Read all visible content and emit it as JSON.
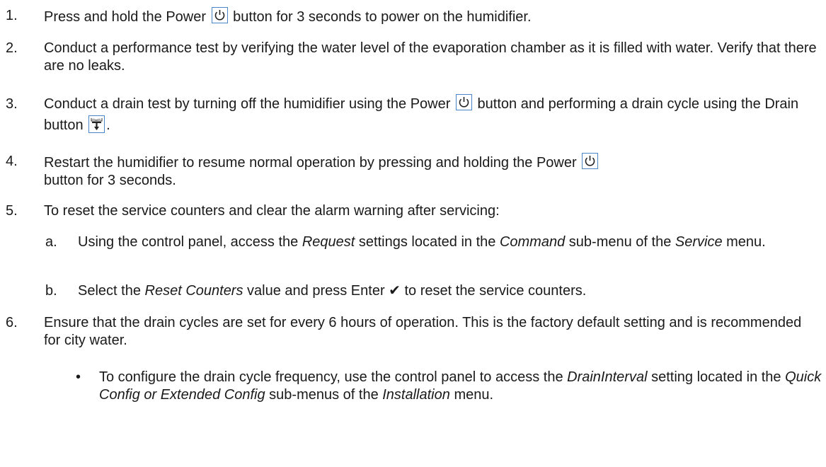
{
  "steps": [
    {
      "num": "1.",
      "parts": {
        "a": "Press and hold the Power",
        "b": "button for 3 seconds to power on the humidifier."
      }
    },
    {
      "num": "2.",
      "parts": {
        "a": "Conduct a performance test by verifying the water level of the evaporation chamber as it is filled with water. Verify that there are no leaks."
      }
    },
    {
      "num": "3.",
      "parts": {
        "a": "Conduct a drain test by turning off the humidifier using the Power",
        "b": "button and performing a drain cycle using the Drain button",
        "c": "."
      }
    },
    {
      "num": "4.",
      "parts": {
        "a": "Restart the humidifier to resume normal operation by pressing and holding the Power",
        "b": "button for 3 seconds."
      }
    },
    {
      "num": "5.",
      "parts": {
        "a": "To reset the service counters and clear the alarm warning after servicing:"
      }
    },
    {
      "num": "6.",
      "parts": {
        "a": "Ensure that the drain cycles are set for every 6 hours of operation. This is the factory default setting and is recommended for city water."
      }
    }
  ],
  "substeps": [
    {
      "num": "a.",
      "parts": {
        "a": "Using the control panel, access the",
        "b": "Request",
        "c": "settings located in the",
        "d": "Command",
        "e": "sub-menu of the",
        "f": "Service",
        "g": "menu."
      }
    },
    {
      "num": "b.",
      "parts": {
        "a": "Select the",
        "b": "Reset Counters",
        "c": "value and press Enter",
        "d": "✔",
        "e": "to reset the service counters."
      }
    }
  ],
  "bullet": {
    "dot": "•",
    "parts": {
      "a": "To configure the drain cycle frequency, use the control panel to access the",
      "b": "DrainInterval",
      "c": "setting located in the",
      "d": "Quick Config or Extended Config",
      "e": "sub-menus of the",
      "f": "Installation",
      "g": "menu."
    }
  },
  "icons": {
    "power": "power-icon",
    "drain": "drain-icon",
    "check": "checkmark-icon"
  },
  "colors": {
    "icon_border": "#4a86c5"
  }
}
